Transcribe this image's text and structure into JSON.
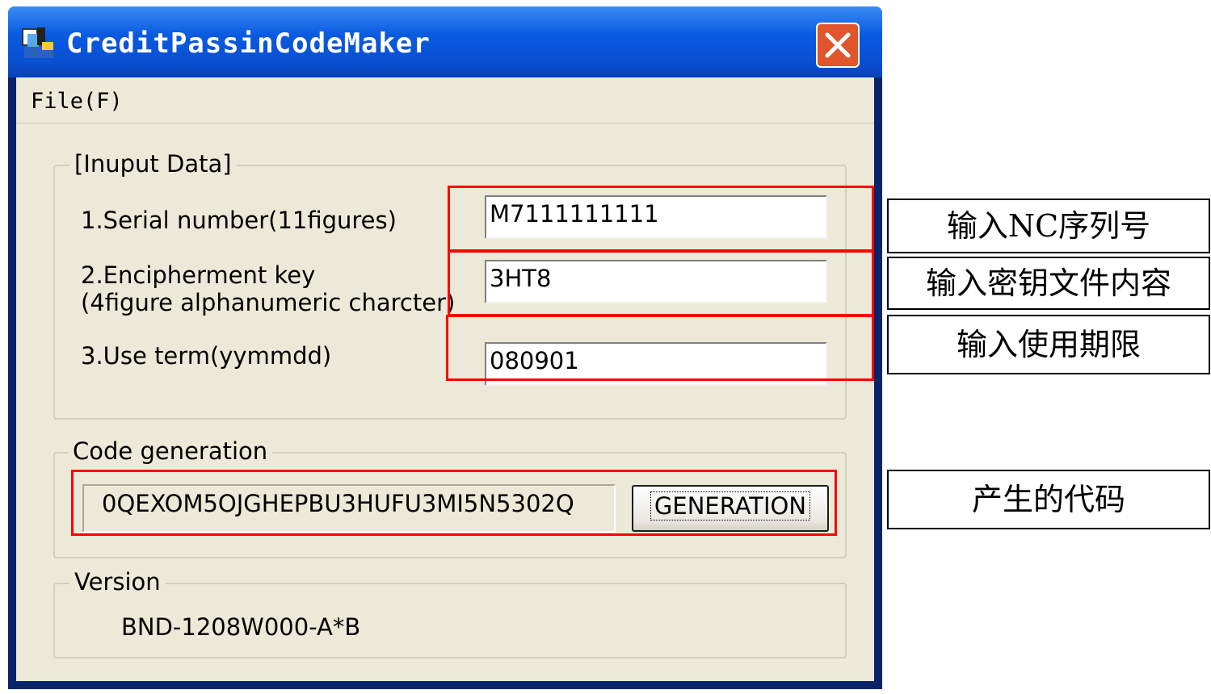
{
  "window": {
    "title": "CreditPassinCodeMaker",
    "close_icon": "close-icon"
  },
  "menu": {
    "file_label": "File(F)"
  },
  "input_group": {
    "legend": "[Inuput Data]",
    "serial_label": "1.Serial number(11figures)",
    "serial_value": "M7111111111",
    "key_label_line1": "2.Encipherment key",
    "key_label_line2": "(4figure alphanumeric charcter)",
    "key_value": "3HT8",
    "term_label": "3.Use term(yymmdd)",
    "term_value": "080901"
  },
  "code_group": {
    "legend": "Code generation",
    "code_value": "0QEXOM5OJGHEPBU3HUFU3MI5N5302Q",
    "generate_button": "GENERATION"
  },
  "version_group": {
    "legend": "Version",
    "version_value": "BND-1208W000-A*B"
  },
  "annotations": {
    "serial_note": "输入NC序列号",
    "key_note": "输入密钥文件内容",
    "term_note": "输入使用期限",
    "code_note": "产生的代码"
  },
  "colors": {
    "highlight": "#ff0000",
    "titlebar": "#0a5ae0",
    "dialog_bg": "#ece9d8"
  }
}
